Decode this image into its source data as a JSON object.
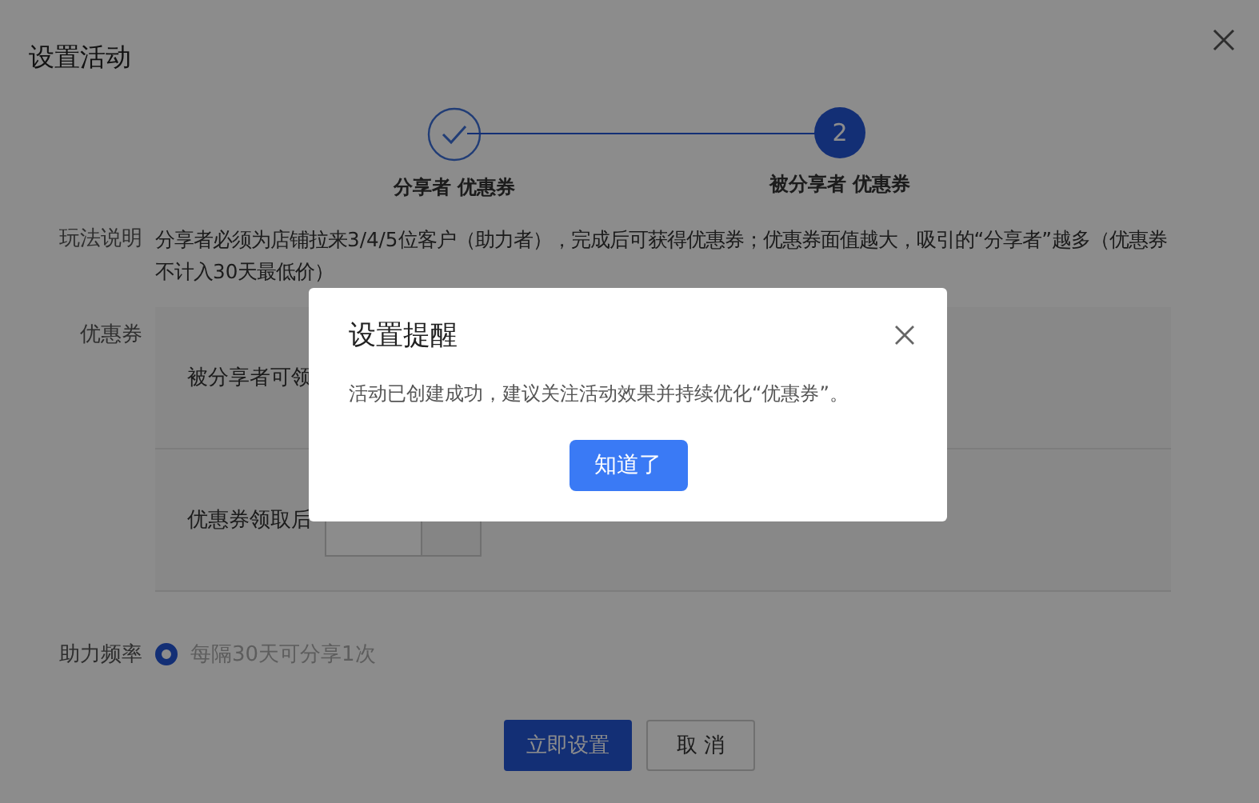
{
  "dialog": {
    "title": "设置活动"
  },
  "steps": [
    {
      "label": "分享者 优惠券",
      "done": true
    },
    {
      "label": "被分享者 优惠券",
      "done": false,
      "number": "2"
    }
  ],
  "rules": {
    "label": "玩法说明",
    "text": "分享者必须为店铺拉来3/4/5位客户（助力者），完成后可获得优惠券；优惠券面值越大，吸引的“分享者”越多（优惠券不计入30天最低价）"
  },
  "coupon": {
    "label": "优惠券",
    "rows": [
      {
        "kind": "text",
        "text": "被分享者可领"
      },
      {
        "kind": "input",
        "text": "优惠券领取后"
      }
    ]
  },
  "frequency": {
    "label": "助力频率",
    "options": [
      {
        "label": "每隔30天可分享1次",
        "selected": true
      }
    ]
  },
  "buttons": [
    {
      "label": "立即设置",
      "kind": "primary"
    },
    {
      "label": "取 消",
      "kind": "default"
    }
  ],
  "modal": {
    "title": "设置提醒",
    "message": "活动已创建成功，建议关注活动效果并持续优化“优惠券”。",
    "button": "知道了"
  }
}
